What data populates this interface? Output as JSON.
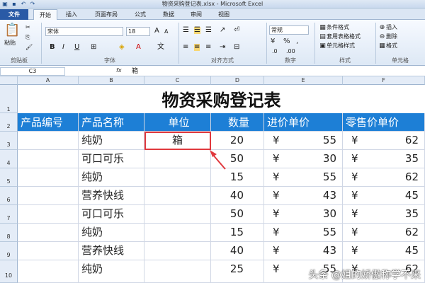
{
  "window": {
    "title": "物资采购登记表.xlsx - Microsoft Excel"
  },
  "tabs": [
    "文件",
    "开始",
    "插入",
    "页面布局",
    "公式",
    "数据",
    "审阅",
    "视图"
  ],
  "ribbon": {
    "clipboard": {
      "paste": "粘贴",
      "label": "剪贴板"
    },
    "font": {
      "name": "宋体",
      "size": "18",
      "grow": "A",
      "shrink": "A",
      "bold": "B",
      "italic": "I",
      "underline": "U",
      "label": "字体"
    },
    "alignment": {
      "label": "对齐方式"
    },
    "number": {
      "format": "常规",
      "currency": "¥",
      "percent": "%",
      "comma": ",",
      "label": "数字"
    },
    "styles": {
      "conditional": "条件格式",
      "table": "套用表格格式",
      "cell": "单元格样式",
      "label": "样式"
    },
    "cells": {
      "insert": "插入",
      "delete": "删除",
      "format": "格式",
      "label": "单元格"
    }
  },
  "formula_bar": {
    "name_box": "C3",
    "fx": "fx",
    "content": "箱"
  },
  "columns": [
    "A",
    "B",
    "C",
    "D",
    "E",
    "F"
  ],
  "rows": [
    "1",
    "2",
    "3",
    "4",
    "5",
    "6",
    "7",
    "8",
    "9",
    "10"
  ],
  "sheet": {
    "title": "物资采购登记表",
    "headers": [
      "产品编号",
      "产品名称",
      "单位",
      "数量",
      "进价单价",
      "零售价单价"
    ],
    "currency_symbol": "¥",
    "data": [
      {
        "name": "纯奶",
        "unit": "箱",
        "qty": "20",
        "cost": "55",
        "retail": "62"
      },
      {
        "name": "可口可乐",
        "unit": "",
        "qty": "50",
        "cost": "30",
        "retail": "35"
      },
      {
        "name": "纯奶",
        "unit": "",
        "qty": "15",
        "cost": "55",
        "retail": "62"
      },
      {
        "name": "营养快线",
        "unit": "",
        "qty": "40",
        "cost": "43",
        "retail": "45"
      },
      {
        "name": "可口可乐",
        "unit": "",
        "qty": "50",
        "cost": "30",
        "retail": "35"
      },
      {
        "name": "纯奶",
        "unit": "",
        "qty": "15",
        "cost": "55",
        "retail": "62"
      },
      {
        "name": "营养快线",
        "unit": "",
        "qty": "40",
        "cost": "43",
        "retail": "45"
      },
      {
        "name": "纯奶",
        "unit": "",
        "qty": "25",
        "cost": "55",
        "retail": "62"
      }
    ]
  },
  "watermark": "头条 @姐的娇傲称学不来"
}
